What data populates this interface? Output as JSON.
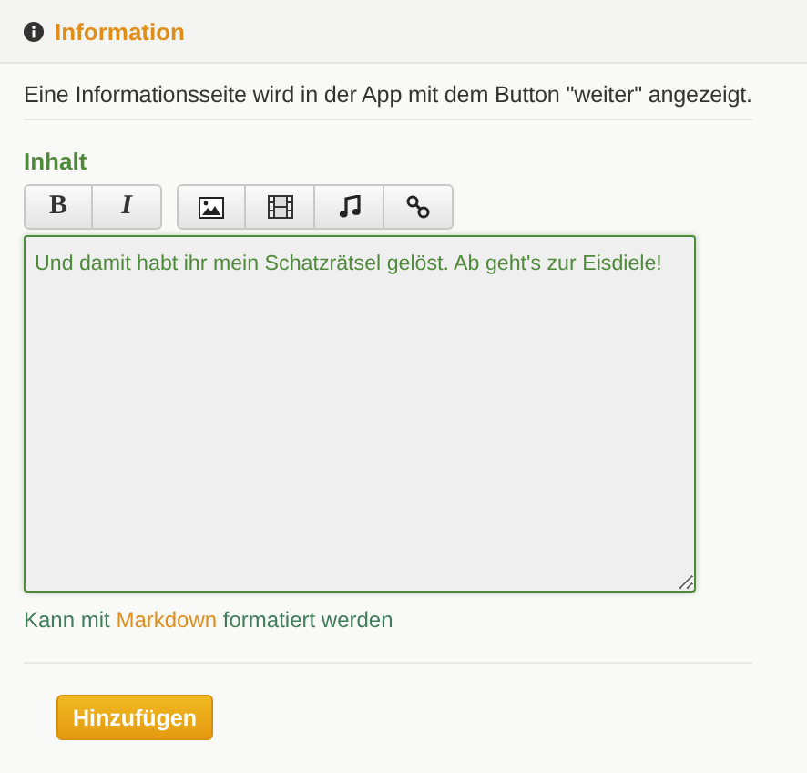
{
  "header": {
    "title": "Information"
  },
  "description": "Eine Informationsseite wird in der App mit dem Button \"weiter\" angezeigt.",
  "field": {
    "label": "Inhalt",
    "toolbar": [
      [
        {
          "kind": "text",
          "label": "B"
        },
        {
          "kind": "text",
          "label": "I"
        }
      ],
      [
        {
          "kind": "image"
        },
        {
          "kind": "film"
        },
        {
          "kind": "music"
        },
        {
          "kind": "link"
        }
      ]
    ],
    "value": "Und damit habt ihr mein Schatzrätsel gelöst. Ab geht's zur Eisdiele!",
    "help": {
      "before": "Kann mit",
      "link": "Markdown",
      "after": "formatiert werden"
    }
  },
  "submit": "Hinzufügen"
}
